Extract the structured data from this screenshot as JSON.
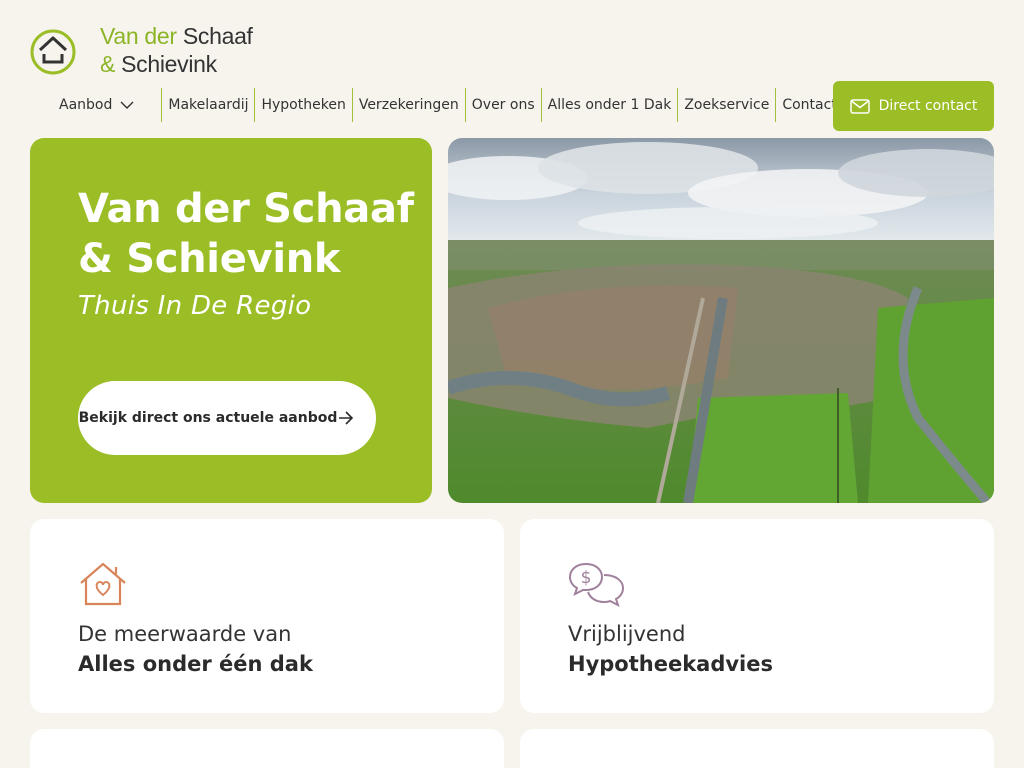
{
  "logo": {
    "line1_green": "Van der",
    "line1_dark": "Schaaf",
    "line2_green": "&",
    "line2_dark": "Schievink"
  },
  "nav": {
    "items": [
      {
        "label": "Aanbod"
      },
      {
        "label": "Makelaardij"
      },
      {
        "label": "Hypotheken"
      },
      {
        "label": "Verzekeringen"
      },
      {
        "label": "Over ons"
      },
      {
        "label": "Alles onder 1 Dak"
      },
      {
        "label": "Zoekservice"
      },
      {
        "label": "Contact"
      }
    ]
  },
  "header": {
    "contact_label": "Direct contact"
  },
  "hero": {
    "title_line1": "Van der Schaaf",
    "title_line2": "& Schievink",
    "subtitle": "Thuis In De Regio",
    "button_label": "Bekijk direct ons actuele aanbod"
  },
  "cards": [
    {
      "line1": "De meerwaarde van",
      "line2": "Alles onder één dak",
      "icon": "house-heart-icon"
    },
    {
      "line1": "Vrijblijvend",
      "line2": "Hypotheekadvies",
      "icon": "speech-bubbles-dollar-icon"
    }
  ],
  "colors": {
    "brand_green": "#9bbd25",
    "background": "#f7f4ee",
    "icon_orange": "#d9855b",
    "icon_purple": "#a0809a"
  }
}
